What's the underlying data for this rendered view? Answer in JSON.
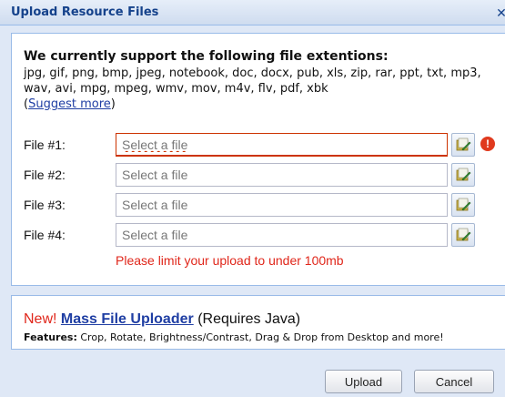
{
  "window": {
    "title": "Upload Resource Files",
    "close_symbol": "✕"
  },
  "intro": {
    "heading": "We currently support the following file extentions:",
    "extensions": "jpg, gif, png, bmp, jpeg, notebook, doc, docx, pub, xls, zip, rar, ppt, txt, mp3, wav, avi, mpg, mpeg, wmv, mov, m4v, flv, pdf, xbk",
    "suggest_open": "(",
    "suggest_link": "Suggest more",
    "suggest_close": ")"
  },
  "files": [
    {
      "label": "File #1:",
      "placeholder": "Select a file",
      "value": "",
      "invalid": true
    },
    {
      "label": "File #2:",
      "placeholder": "Select a file",
      "value": "",
      "invalid": false
    },
    {
      "label": "File #3:",
      "placeholder": "Select a file",
      "value": "",
      "invalid": false
    },
    {
      "label": "File #4:",
      "placeholder": "Select a file",
      "value": "",
      "invalid": false
    }
  ],
  "icons": {
    "browse": "browse-folder-icon",
    "error": "error-icon",
    "error_symbol": "!"
  },
  "limit_note": "Please limit your upload to under 100mb",
  "promo": {
    "new_label": "New!",
    "link_text": "Mass File Uploader",
    "requires": "(Requires Java)",
    "features_label": "Features:",
    "features_text": "Crop, Rotate, Brightness/Contrast, Drag & Drop from Desktop and more!"
  },
  "buttons": {
    "upload": "Upload",
    "cancel": "Cancel"
  },
  "colors": {
    "title_text": "#15428b",
    "error_red": "#e0261a",
    "link_blue": "#1f3ea3",
    "panel_border": "#99bbe8",
    "dialog_bg": "#dfe8f6"
  }
}
